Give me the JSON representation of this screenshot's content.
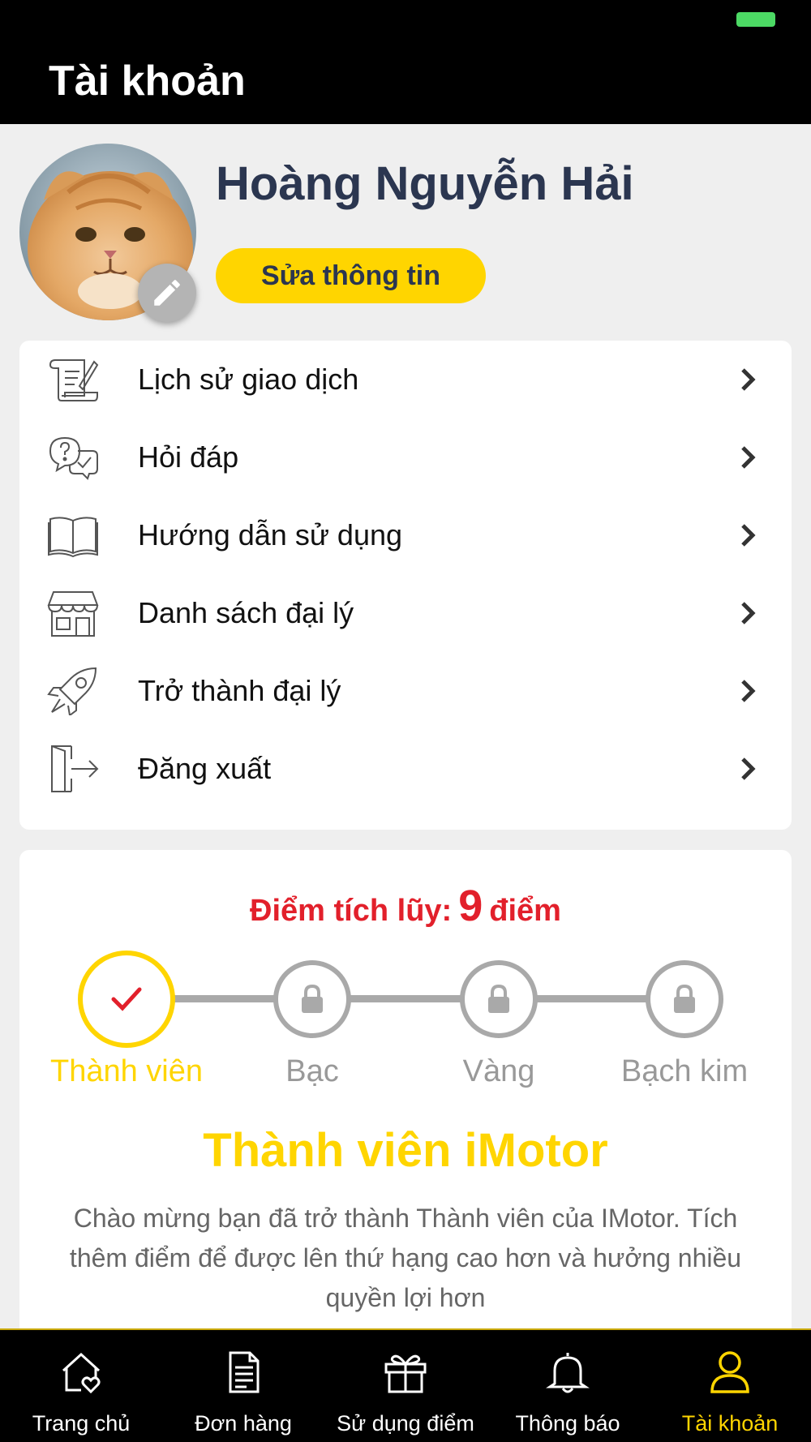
{
  "header": {
    "title": "Tài khoản"
  },
  "profile": {
    "name": "Hoàng Nguyễn Hải",
    "edit_button_label": "Sửa thông tin",
    "avatar_icon": "avatar",
    "avatar_edit_icon": "pencil-icon"
  },
  "menu": {
    "items": [
      {
        "label": "Lịch sử giao dịch",
        "icon": "scroll-icon"
      },
      {
        "label": "Hỏi đáp",
        "icon": "faq-chat-icon"
      },
      {
        "label": "Hướng dẫn sử dụng",
        "icon": "book-icon"
      },
      {
        "label": "Danh sách đại lý",
        "icon": "store-icon"
      },
      {
        "label": "Trở thành đại lý",
        "icon": "rocket-icon"
      },
      {
        "label": "Đăng xuất",
        "icon": "logout-icon"
      }
    ],
    "chevron_icon": "chevron-right-icon"
  },
  "points": {
    "label": "Điểm tích lũy:",
    "value": "9",
    "unit": "điểm"
  },
  "tiers": {
    "items": [
      {
        "label": "Thành viên",
        "state": "active",
        "icon": "check-icon"
      },
      {
        "label": "Bạc",
        "state": "locked",
        "icon": "lock-icon"
      },
      {
        "label": "Vàng",
        "state": "locked",
        "icon": "lock-icon"
      },
      {
        "label": "Bạch kim",
        "state": "locked",
        "icon": "lock-icon"
      }
    ],
    "current_title": "Thành viên iMotor",
    "description": "Chào mừng bạn đã trở thành Thành viên của IMotor. Tích thêm điểm để được lên thứ hạng cao hơn và hưởng nhiều quyền lợi hơn"
  },
  "tabbar": {
    "tabs": [
      {
        "label": "Trang chủ",
        "icon": "home-heart-icon",
        "active": false
      },
      {
        "label": "Đơn hàng",
        "icon": "document-icon",
        "active": false
      },
      {
        "label": "Sử dụng điểm",
        "icon": "gift-icon",
        "active": false
      },
      {
        "label": "Thông báo",
        "icon": "bell-icon",
        "active": false
      },
      {
        "label": "Tài khoản",
        "icon": "user-icon",
        "active": true
      }
    ]
  },
  "colors": {
    "accent": "#ffd500",
    "points_red": "#e2202b",
    "name_navy": "#2b3650",
    "locked_gray": "#a9a9a9"
  }
}
